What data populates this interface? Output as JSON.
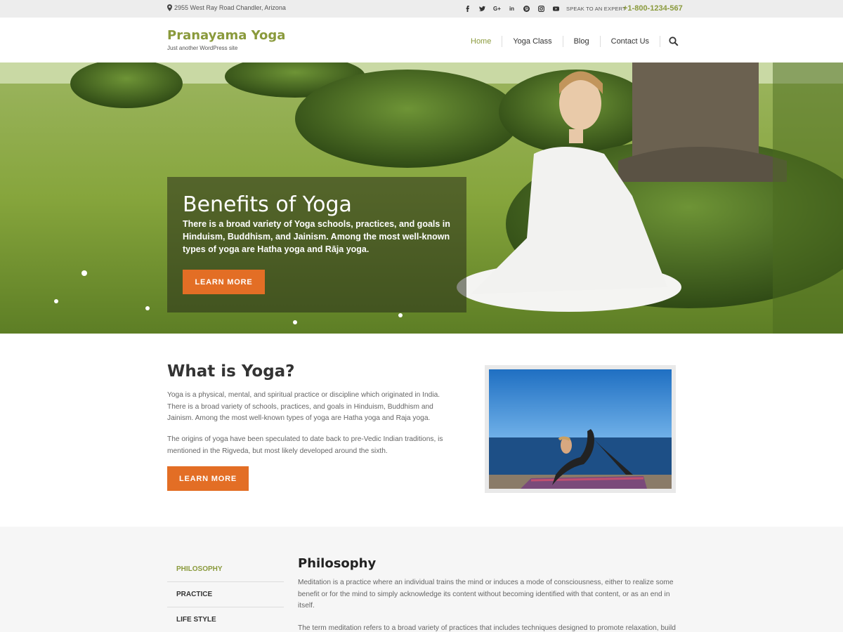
{
  "topbar": {
    "address": "2955 West Ray Road Chandler, Arizona",
    "socials": [
      "facebook-icon",
      "twitter-icon",
      "google-plus-icon",
      "linkedin-icon",
      "pinterest-icon",
      "instagram-icon",
      "youtube-icon"
    ],
    "speak_label": "SPEAK TO AN EXPERT",
    "phone": "+1-800-1234-567"
  },
  "header": {
    "site_title": "Pranayama Yoga",
    "tagline": "Just another WordPress site",
    "nav": [
      "Home",
      "Yoga Class",
      "Blog",
      "Contact Us"
    ],
    "active_nav": "Home"
  },
  "hero": {
    "title": "Benefits of Yoga",
    "text": "There is a broad variety of Yoga schools, practices, and goals in Hinduism, Buddhism, and Jainism. Among the most well-known types of yoga are Hatha yoga and Rāja yoga.",
    "button": "LEARN MORE"
  },
  "about": {
    "title": "What is Yoga?",
    "p1": "Yoga is a physical, mental, and spiritual practice or discipline which originated in India. There is a broad variety of schools, practices, and goals in Hinduism, Buddhism and Jainism. Among the most well-known types of yoga are Hatha yoga and Raja yoga.",
    "p2": "The origins of yoga have been speculated to date back to pre-Vedic Indian traditions, is mentioned in the Rigveda, but most likely developed around the sixth.",
    "button": "LEARN MORE"
  },
  "tabs": {
    "items": [
      "PHILOSOPHY",
      "PRACTICE",
      "LIFE STYLE"
    ],
    "active": "PHILOSOPHY",
    "content_title": "Philosophy",
    "content_p1": "Meditation is a practice where an individual trains the mind or induces a mode of consciousness, either to realize some benefit or for the mind to simply acknowledge its content without becoming identified with that content, or as an end in itself.",
    "content_p2": "The term meditation refers to a broad variety of practices that includes techniques designed to promote relaxation, build"
  },
  "colors": {
    "accent_green": "#8a9a3c",
    "button_orange": "#e36e25"
  }
}
